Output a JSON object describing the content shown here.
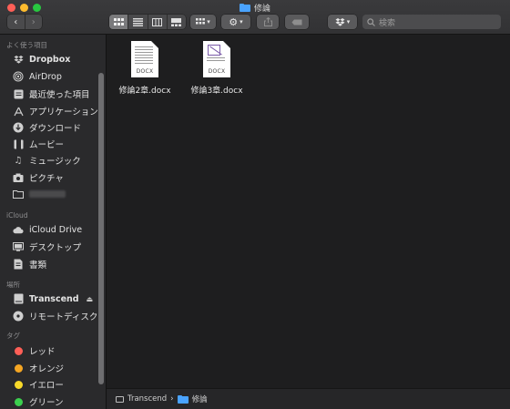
{
  "window": {
    "title": "修論"
  },
  "toolbar": {
    "back_icon": "chevron-left-icon",
    "forward_icon": "chevron-right-icon",
    "view_modes": [
      "icon-view-icon",
      "list-view-icon",
      "column-view-icon",
      "gallery-view-icon"
    ],
    "search_placeholder": "検索"
  },
  "sidebar": {
    "favorites_header": "よく使う項目",
    "favorites": [
      {
        "label": "Dropbox",
        "icon": "dropbox-icon"
      },
      {
        "label": "AirDrop",
        "icon": "airdrop-icon"
      },
      {
        "label": "最近使った項目",
        "icon": "recents-icon"
      },
      {
        "label": "アプリケーション",
        "icon": "applications-icon"
      },
      {
        "label": "ダウンロード",
        "icon": "downloads-icon"
      },
      {
        "label": "ムービー",
        "icon": "movies-icon"
      },
      {
        "label": "ミュージック",
        "icon": "music-icon"
      },
      {
        "label": "ピクチャ",
        "icon": "pictures-icon"
      }
    ],
    "icloud_header": "iCloud",
    "icloud": [
      {
        "label": "iCloud Drive",
        "icon": "icloud-icon"
      },
      {
        "label": "デスクトップ",
        "icon": "desktop-icon"
      },
      {
        "label": "書類",
        "icon": "documents-icon"
      }
    ],
    "locations_header": "場所",
    "locations": [
      {
        "label": "Transcend",
        "icon": "external-drive-icon"
      },
      {
        "label": "リモートディスク",
        "icon": "remote-disc-icon"
      }
    ],
    "tags_header": "タグ",
    "tags": [
      {
        "label": "レッド",
        "color": "#ff5f57"
      },
      {
        "label": "オレンジ",
        "color": "#f5a623"
      },
      {
        "label": "イエロー",
        "color": "#f8d92a"
      },
      {
        "label": "グリーン",
        "color": "#3ccf4e"
      }
    ]
  },
  "files": [
    {
      "name": "修論2章.docx",
      "ext": "DOCX"
    },
    {
      "name": "修論3章.docx",
      "ext": "DOCX"
    }
  ],
  "pathbar": {
    "segments": [
      "Transcend",
      "修論"
    ],
    "separator": "›"
  }
}
